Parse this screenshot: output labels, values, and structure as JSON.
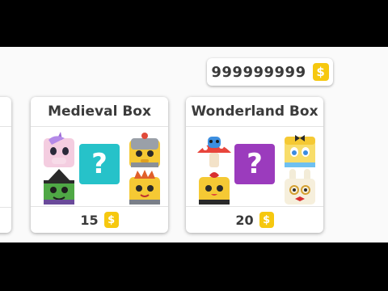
{
  "currency": {
    "amount": "999999999",
    "icon": "dollar-coin-icon",
    "symbol": "$",
    "color": "#f6c80f"
  },
  "boxes": [
    {
      "title": "Medieval Box",
      "price": "15",
      "mystery_color": "#26c2c9",
      "mystery_symbol": "?",
      "pets": [
        "unicorn-pet-icon",
        "knight-pet-icon",
        "witch-pet-icon",
        "queen-pet-icon"
      ]
    },
    {
      "title": "Wonderland Box",
      "price": "20",
      "mystery_color": "#9b3bbd",
      "mystery_symbol": "?",
      "pets": [
        "mushroom-caterpillar-pet-icon",
        "alice-pet-icon",
        "queen-of-hearts-pet-icon",
        "white-rabbit-pet-icon"
      ]
    }
  ],
  "price_symbol": "$"
}
